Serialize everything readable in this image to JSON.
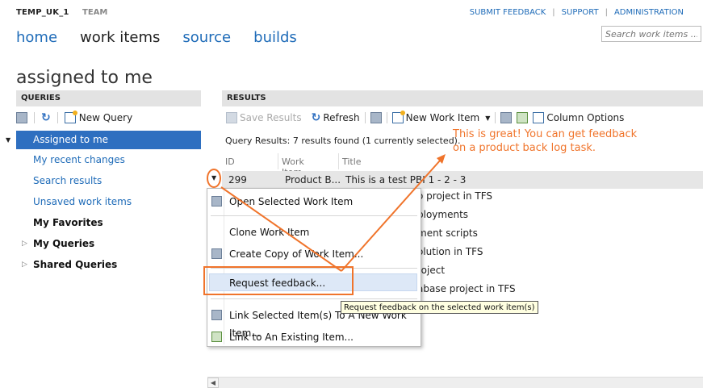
{
  "header": {
    "project": "TEMP_UK_1",
    "team": "TEAM",
    "links": [
      "SUBMIT FEEDBACK",
      "SUPPORT",
      "ADMINISTRATION"
    ]
  },
  "nav": {
    "items": [
      {
        "label": "home"
      },
      {
        "label": "work items"
      },
      {
        "label": "source"
      },
      {
        "label": "builds"
      }
    ]
  },
  "search": {
    "placeholder": "Search work items ..."
  },
  "page": {
    "title": "assigned to me"
  },
  "queries": {
    "header": "QUERIES",
    "new_query": "New Query",
    "items": [
      {
        "label": "Assigned to me"
      },
      {
        "label": "My recent changes"
      },
      {
        "label": "Search results"
      },
      {
        "label": "Unsaved work items"
      },
      {
        "label": "My Favorites"
      },
      {
        "label": "My Queries"
      },
      {
        "label": "Shared Queries"
      }
    ]
  },
  "results": {
    "header": "RESULTS",
    "toolbar": {
      "save": "Save Results",
      "refresh": "Refresh",
      "new_work_item": "New Work Item",
      "column_options": "Column Options"
    },
    "info": "Query Results: 7 results found (1 currently selected).",
    "columns": [
      "ID",
      "Work Item...",
      "Title"
    ],
    "selected_row": {
      "id": "299",
      "type": "Product B...",
      "title": "This is a test PBI 1 - 2 - 3"
    },
    "partial_titles": [
      "o project in TFS",
      "ployments",
      "ment scripts",
      "olution in TFS",
      "roject",
      "abase project in TFS"
    ]
  },
  "context_menu": {
    "items": [
      {
        "label": "Open Selected Work Item"
      },
      {
        "label": "Clone Work Item"
      },
      {
        "label": "Create Copy of Work Item..."
      },
      {
        "label": "Request feedback..."
      },
      {
        "label": "Link Selected Item(s) To A New Work Item..."
      },
      {
        "label": "Link to An Existing Item..."
      }
    ]
  },
  "tooltip": "Request feedback on the selected work item(s)",
  "callout": {
    "line1": "This is great! You can get feedback",
    "line2": "on a product back log task."
  },
  "colors": {
    "accent": "#1e6bb8",
    "selection": "#2e6fc0",
    "annotation": "#f0742b"
  }
}
